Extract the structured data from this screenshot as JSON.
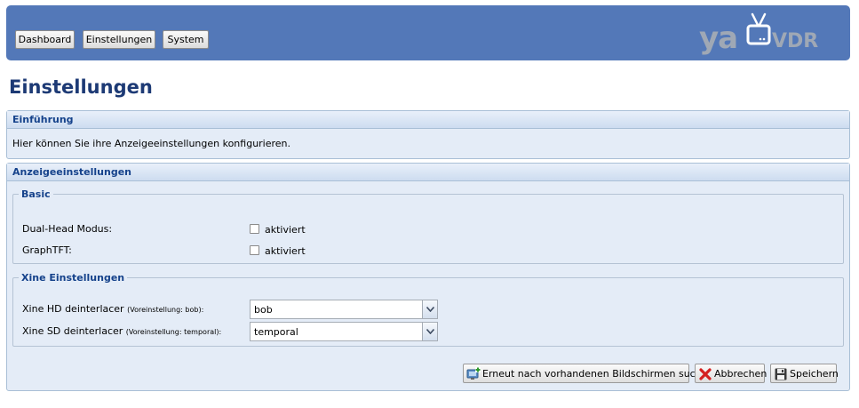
{
  "nav": {
    "dashboard": "Dashboard",
    "einstellungen": "Einstellungen",
    "system": "System"
  },
  "logo": {
    "ya": "ya",
    "vdr": "VDR"
  },
  "page_title": "Einstellungen",
  "intro": {
    "title": "Einführung",
    "text": "Hier können Sie ihre Anzeigeeinstellungen konfigurieren."
  },
  "display": {
    "title": "Anzeigeeinstellungen",
    "basic": {
      "legend": "Basic",
      "dual_head": {
        "label": "Dual-Head Modus:",
        "checkbox_label": "aktiviert",
        "checked": false
      },
      "graphtft": {
        "label": "GraphTFT:",
        "checkbox_label": "aktiviert",
        "checked": false
      }
    },
    "xine": {
      "legend": "Xine Einstellungen",
      "hd": {
        "label": "Xine HD deinterlacer",
        "hint": "(Voreinstellung: bob):",
        "value": "bob"
      },
      "sd": {
        "label": "Xine SD deinterlacer",
        "hint": "(Voreinstellung: temporal):",
        "value": "temporal"
      }
    }
  },
  "footer": {
    "rescan": "Erneut nach vorhandenen Bildschirmen suchen",
    "cancel": "Abbrechen",
    "save": "Speichern"
  },
  "colors": {
    "header_bg": "#5378b8",
    "panel_bg": "#e4ecf7",
    "title_blue": "#1d3a75",
    "section_blue": "#15428b"
  }
}
